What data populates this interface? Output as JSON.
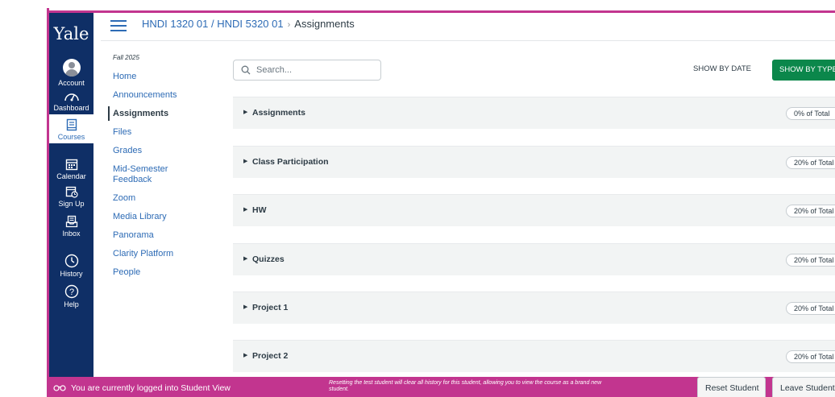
{
  "global_nav": {
    "logo": "Yale",
    "items": [
      {
        "label": "Account",
        "icon": "account-avatar-icon"
      },
      {
        "label": "Dashboard",
        "icon": "dashboard-icon"
      },
      {
        "label": "Courses",
        "icon": "courses-icon",
        "active": true
      },
      {
        "label": "Calendar",
        "icon": "calendar-icon"
      },
      {
        "label": "Sign Up",
        "icon": "sign-up-icon"
      },
      {
        "label": "Inbox",
        "icon": "inbox-icon"
      },
      {
        "label": "History",
        "icon": "history-icon"
      },
      {
        "label": "Help",
        "icon": "help-icon"
      }
    ]
  },
  "header": {
    "breadcrumb_course": "HNDI 1320 01 / HNDI 5320 01",
    "breadcrumb_separator": "›",
    "breadcrumb_current": "Assignments"
  },
  "course_nav": {
    "term": "Fall 2025",
    "links": [
      "Home",
      "Announcements",
      "Assignments",
      "Files",
      "Grades",
      "Mid-Semester Feedback",
      "Zoom",
      "Media Library",
      "Panorama",
      "Clarity Platform",
      "People"
    ],
    "active": "Assignments"
  },
  "toolbar": {
    "search_placeholder": "Search...",
    "show_by_date": "SHOW BY DATE",
    "show_by_type": "SHOW BY TYPE"
  },
  "groups": [
    {
      "name": "Assignments",
      "weight": "0% of Total"
    },
    {
      "name": "Class Participation",
      "weight": "20% of Total"
    },
    {
      "name": "HW",
      "weight": "20% of Total"
    },
    {
      "name": "Quizzes",
      "weight": "20% of Total"
    },
    {
      "name": "Project 1",
      "weight": "20% of Total"
    },
    {
      "name": "Project 2",
      "weight": "20% of Total"
    }
  ],
  "student_view": {
    "message": "You are currently logged into Student View",
    "note": "Resetting the test student will clear all history for this student, allowing you to view the course as a brand new student.",
    "reset_button": "Reset Student",
    "leave_button": "Leave Student View"
  },
  "colors": {
    "nav_background": "#0f2f66",
    "link": "#2d6bb5",
    "student_view": "#c2358f",
    "primary_button": "#0b874b"
  }
}
